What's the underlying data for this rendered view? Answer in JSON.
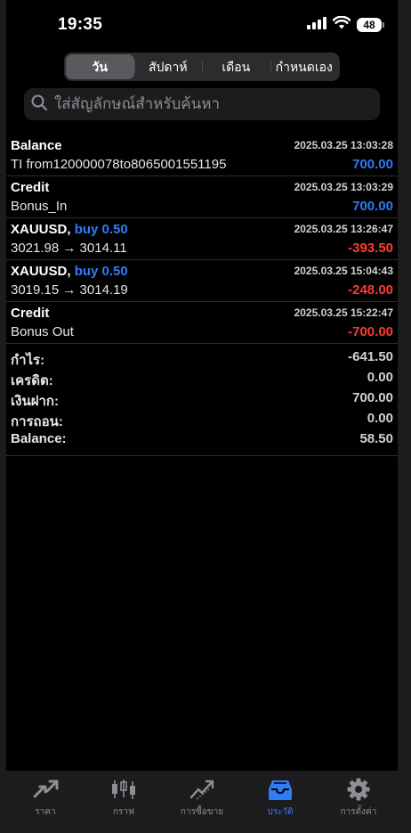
{
  "status": {
    "time": "19:35",
    "battery": "48"
  },
  "segments": [
    {
      "label": "วัน",
      "active": true
    },
    {
      "label": "สัปดาห์",
      "active": false
    },
    {
      "label": "เดือน",
      "active": false
    },
    {
      "label": "กำหนดเอง",
      "active": false
    }
  ],
  "search": {
    "placeholder": "ใส่สัญลักษณ์สำหรับค้นหา"
  },
  "deals": [
    {
      "title": "Balance",
      "side": "",
      "date": "2025.03.25 13:03:28",
      "desc": "TI from120000078to8065001551195",
      "amount": "700.00",
      "amount_color": "#2f7cf6"
    },
    {
      "title": "Credit",
      "side": "",
      "date": "2025.03.25 13:03:29",
      "desc": "Bonus_In",
      "amount": "700.00",
      "amount_color": "#2f7cf6"
    },
    {
      "title": "XAUUSD,",
      "side": "buy 0.50",
      "date": "2025.03.25 13:26:47",
      "desc": "3021.98 → 3014.11",
      "amount": "-393.50",
      "amount_color": "#ff3b30"
    },
    {
      "title": "XAUUSD,",
      "side": "buy 0.50",
      "date": "2025.03.25 15:04:43",
      "desc": "3019.15 → 3014.19",
      "amount": "-248.00",
      "amount_color": "#ff3b30"
    },
    {
      "title": "Credit",
      "side": "",
      "date": "2025.03.25 15:22:47",
      "desc": "Bonus Out",
      "amount": "-700.00",
      "amount_color": "#ff3b30"
    }
  ],
  "summary": {
    "profit_label": "กำไร:",
    "profit": "-641.50",
    "credit_label": "เครดิต:",
    "credit": "0.00",
    "deposit_label": "เงินฝาก:",
    "deposit": "700.00",
    "withdrawal_label": "การถอน:",
    "withdrawal": "0.00",
    "balance_label": "Balance:",
    "balance": "58.50"
  },
  "tabs": [
    {
      "label": "ราคา",
      "icon": "quotes-icon",
      "active": false
    },
    {
      "label": "กราฟ",
      "icon": "chart-icon",
      "active": false
    },
    {
      "label": "การซื้อขาย",
      "icon": "trade-icon",
      "active": false
    },
    {
      "label": "ประวัติ",
      "icon": "history-icon",
      "active": true
    },
    {
      "label": "การตั้งค่า",
      "icon": "settings-icon",
      "active": false
    }
  ],
  "colors": {
    "accent": "#2f7cf6",
    "loss": "#ff3b30",
    "background": "#000000"
  }
}
